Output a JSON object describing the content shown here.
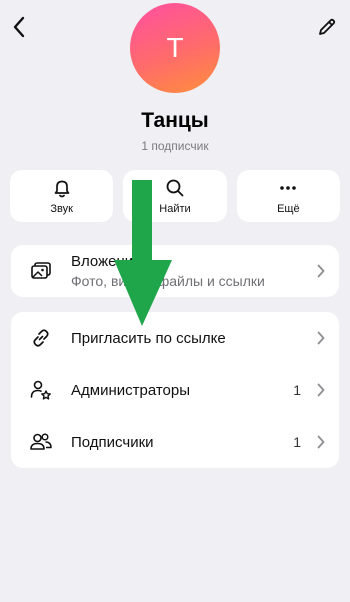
{
  "header": {
    "back_icon": "chevron-left-icon",
    "edit_icon": "pencil-icon"
  },
  "profile": {
    "avatar_letter": "Т",
    "name": "Танцы",
    "subscribers": "1 подписчик"
  },
  "actions": [
    {
      "label": "Звук",
      "icon": "bell-icon"
    },
    {
      "label": "Найти",
      "icon": "search-icon"
    },
    {
      "label": "Ещё",
      "icon": "more-dots-icon"
    }
  ],
  "attachments": {
    "title": "Вложения",
    "subtitle": "Фото, видео, файлы и ссылки"
  },
  "settings": [
    {
      "label": "Пригласить по ссылке",
      "icon": "link-icon",
      "count": ""
    },
    {
      "label": "Администраторы",
      "icon": "admin-star-icon",
      "count": "1"
    },
    {
      "label": "Подписчики",
      "icon": "people-icon",
      "count": "1"
    }
  ],
  "overlay": {
    "arrow_color": "#1fa64a"
  }
}
